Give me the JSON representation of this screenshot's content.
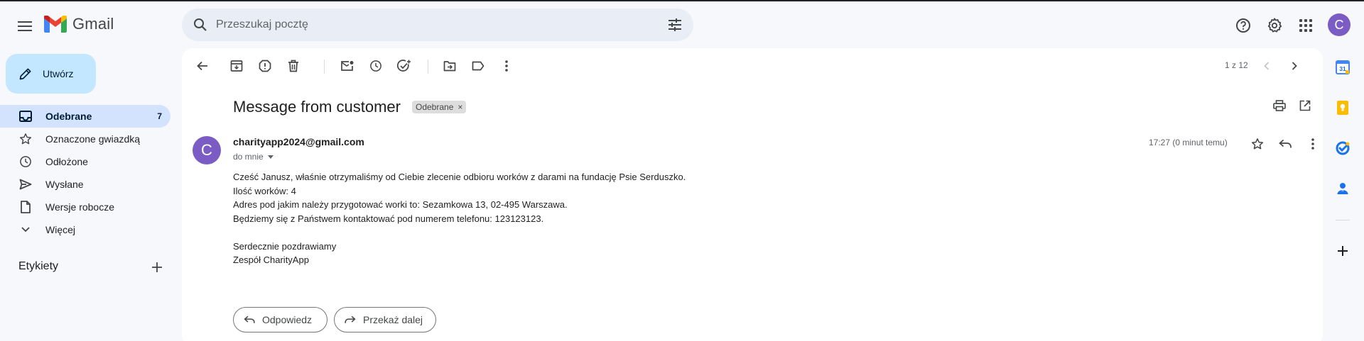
{
  "app": {
    "name": "Gmail",
    "account_initial": "C",
    "colors": {
      "accent": "#0b57d0",
      "avatar": "#7b5cc4",
      "compose_bg": "#c2e7ff",
      "active_nav": "#d3e3fd"
    }
  },
  "header": {
    "search_placeholder": "Przeszukaj pocztę",
    "icons": [
      "menu-icon",
      "search-icon",
      "tune-icon",
      "help-icon",
      "settings-icon",
      "apps-icon"
    ]
  },
  "sidebar": {
    "compose_label": "Utwórz",
    "items": [
      {
        "label": "Odebrane",
        "count": "7",
        "icon": "inbox-icon",
        "active": true
      },
      {
        "label": "Oznaczone gwiazdką",
        "count": "",
        "icon": "star-icon"
      },
      {
        "label": "Odłożone",
        "count": "",
        "icon": "clock-icon"
      },
      {
        "label": "Wysłane",
        "count": "",
        "icon": "send-icon"
      },
      {
        "label": "Wersje robocze",
        "count": "",
        "icon": "draft-icon"
      },
      {
        "label": "Więcej",
        "count": "",
        "icon": "chevron-down-icon"
      }
    ],
    "labels_heading": "Etykiety"
  },
  "toolbar": {
    "pager": "1 z 12"
  },
  "message": {
    "subject": "Message from customer",
    "label_chip": "Odebrane",
    "chip_close": "×",
    "sender_initial": "C",
    "sender": "charityapp2024@gmail.com",
    "to": "do mnie",
    "time": "17:27 (0 minut temu)",
    "body": [
      "Cześć Janusz, właśnie otrzymaliśmy od Ciebie zlecenie odbioru worków z darami na fundację Psie Serduszko.",
      "Ilość worków: 4",
      "Adres pod jakim należy przygotować worki to: Sezamkowa 13, 02-495 Warszawa.",
      "Będziemy się z Państwem kontaktować pod numerem telefonu: 123123123.",
      "",
      "Serdecznie pozdrawiamy",
      "Zespół CharityApp"
    ],
    "reply_label": "Odpowiedz",
    "forward_label": "Przekaż dalej"
  },
  "right_rail": {
    "icons": [
      "calendar-icon",
      "keep-icon",
      "tasks-icon",
      "contacts-icon",
      "add-icon"
    ],
    "calendar_day": "31"
  }
}
